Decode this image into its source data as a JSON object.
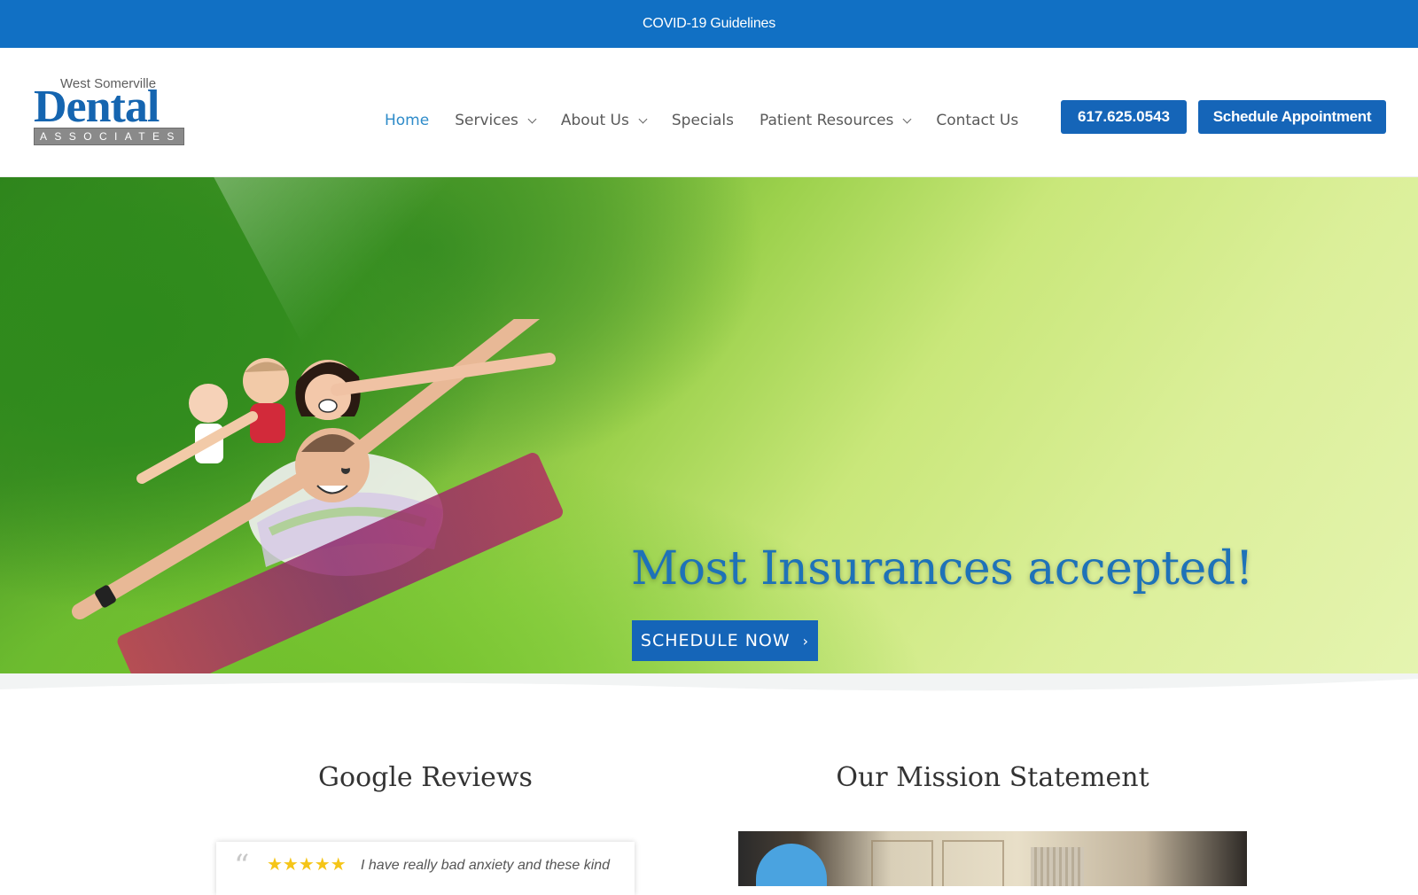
{
  "topbar": {
    "link_label": "COVID-19 Guidelines",
    "bg_color": "#1170c4"
  },
  "logo": {
    "line1": "West Somerville",
    "line2": "Dental",
    "line3": "ASSOCIATES"
  },
  "nav": {
    "items": [
      {
        "label": "Home",
        "active": true,
        "has_dropdown": false
      },
      {
        "label": "Services",
        "active": false,
        "has_dropdown": true
      },
      {
        "label": "About Us",
        "active": false,
        "has_dropdown": true
      },
      {
        "label": "Specials",
        "active": false,
        "has_dropdown": false
      },
      {
        "label": "Patient Resources",
        "active": false,
        "has_dropdown": true
      },
      {
        "label": "Contact Us",
        "active": false,
        "has_dropdown": false
      }
    ],
    "phone_button": "617.625.0543",
    "schedule_button": "Schedule Appointment",
    "accent_color": "#1565b8"
  },
  "hero": {
    "title": "Most Insurances accepted!",
    "cta_label": "SCHEDULE NOW",
    "cta_arrow": "›"
  },
  "sections": {
    "reviews": {
      "title": "Google Reviews",
      "quote_mark": "“",
      "stars": "★★★★★",
      "review_text": "I have really bad anxiety and these kind"
    },
    "mission": {
      "title": "Our Mission Statement"
    }
  }
}
